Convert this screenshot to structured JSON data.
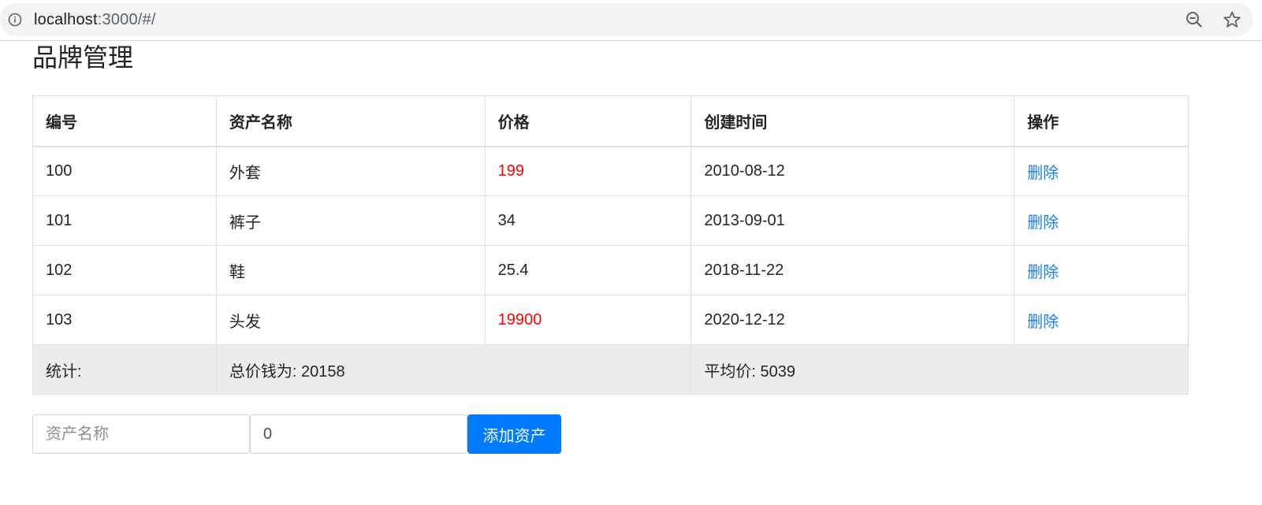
{
  "browser": {
    "url_host": "localhost",
    "url_rest": ":3000/#/",
    "icons": [
      "info-icon",
      "zoom-out-icon",
      "bookmark-star-icon"
    ]
  },
  "page": {
    "title": "品牌管理"
  },
  "table": {
    "headers": [
      "编号",
      "资产名称",
      "价格",
      "创建时间",
      "操作"
    ],
    "rows": [
      {
        "id": "100",
        "name": "外套",
        "price": "199",
        "price_high": true,
        "created": "2010-08-12",
        "action": "删除"
      },
      {
        "id": "101",
        "name": "裤子",
        "price": "34",
        "price_high": false,
        "created": "2013-09-01",
        "action": "删除"
      },
      {
        "id": "102",
        "name": "鞋",
        "price": "25.4",
        "price_high": false,
        "created": "2018-11-22",
        "action": "删除"
      },
      {
        "id": "103",
        "name": "头发",
        "price": "19900",
        "price_high": true,
        "created": "2020-12-12",
        "action": "删除"
      }
    ],
    "footer": {
      "label": "统计:",
      "total": "总价钱为: 20158",
      "average": "平均价: 5039"
    }
  },
  "form": {
    "name_placeholder": "资产名称",
    "name_value": "",
    "price_value": "0",
    "submit_label": "添加资产"
  },
  "colors": {
    "high_price": "#ff0000",
    "link": "#1a7ff0",
    "primary_button": "#007bff",
    "footer_bg": "#ececec"
  }
}
